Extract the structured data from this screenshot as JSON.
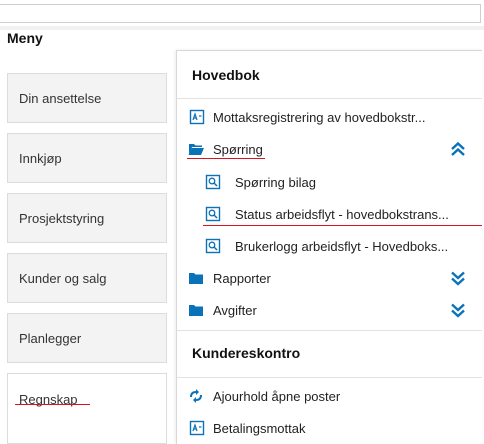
{
  "menu": {
    "title": "Meny",
    "items": [
      {
        "label": "Din ansettelse"
      },
      {
        "label": "Innkjøp"
      },
      {
        "label": "Prosjektstyring"
      },
      {
        "label": "Kunder og salg"
      },
      {
        "label": "Planlegger"
      },
      {
        "label": "Regnskap"
      }
    ],
    "active_item": "Regnskap"
  },
  "panel": {
    "section1": {
      "title": "Hovedbok",
      "items": [
        {
          "label": "Mottaksregistrering av hovedbokstr...",
          "icon": "report-icon"
        },
        {
          "label": "Spørring",
          "icon": "folder-open-icon",
          "expanded": true
        },
        {
          "label": "Spørring bilag",
          "icon": "query-icon"
        },
        {
          "label": "Status arbeidsflyt - hovedbokstrans...",
          "icon": "query-icon"
        },
        {
          "label": "Brukerlogg arbeidsflyt - Hovedboks...",
          "icon": "query-icon"
        },
        {
          "label": "Rapporter",
          "icon": "folder-icon",
          "expanded": false
        },
        {
          "label": "Avgifter",
          "icon": "folder-icon",
          "expanded": false
        }
      ]
    },
    "section2": {
      "title": "Kundereskontro",
      "items": [
        {
          "label": "Ajourhold åpne poster",
          "icon": "adjust-icon"
        },
        {
          "label": "Betalingsmottak",
          "icon": "report-icon"
        }
      ]
    }
  },
  "colors": {
    "accent_blue": "#0a72b8",
    "highlight_red": "#d9141f",
    "tile_bg": "#f3f3f3"
  }
}
